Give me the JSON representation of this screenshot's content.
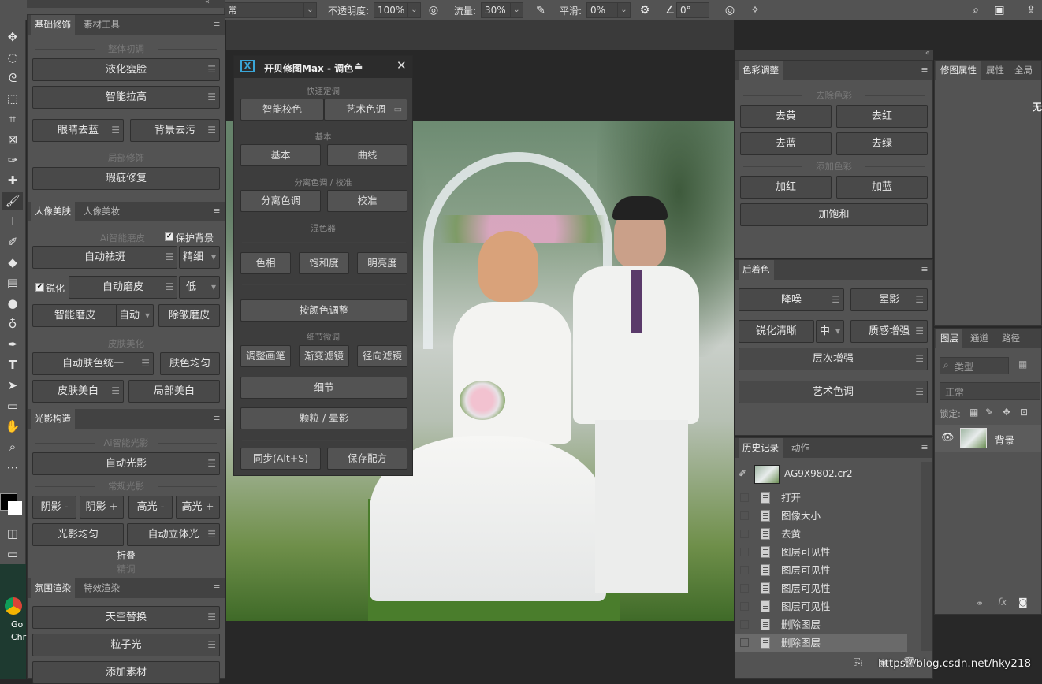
{
  "options_bar": {
    "mode_value": "常",
    "opacity_label": "不透明度:",
    "opacity_value": "100%",
    "flow_label": "流量:",
    "flow_value": "30%",
    "smooth_label": "平滑:",
    "smooth_value": "0%",
    "angle_value": "0°"
  },
  "left_panel": {
    "tabs1": [
      "基础修饰",
      "素材工具"
    ],
    "sec_overall": "整体初调",
    "btn_liquify": "液化瘦脸",
    "btn_stretch": "智能拉高",
    "btn_eye": "眼睛去蓝",
    "btn_bg": "背景去污",
    "sec_local": "局部修饰",
    "btn_blemish": "瑕疵修复",
    "tabs2": [
      "人像美肤",
      "人像美妆"
    ],
    "ai_skin": "Ai智能磨皮",
    "protect_bg": "保护背景",
    "btn_auto_spot": "自动祛斑",
    "fine_value": "精细",
    "sharpen_label": "锐化",
    "btn_auto_smooth": "自动磨皮",
    "low_value": "低",
    "btn_smart_smooth": "智能磨皮",
    "auto_value": "自动",
    "btn_wrinkle": "除皱磨皮",
    "sec_skin": "皮肤美化",
    "btn_tone_unify": "自动肤色统一",
    "btn_tone_even": "肤色均匀",
    "btn_whiten": "皮肤美白",
    "btn_local_whiten": "局部美白",
    "tabs3": [
      "光影构造"
    ],
    "ai_light": "Ai智能光影",
    "btn_auto_light": "自动光影",
    "sec_normal_light": "常规光影",
    "btn_shadow_minus": "阴影 -",
    "btn_shadow_plus": "阴影 +",
    "btn_high_minus": "高光 -",
    "btn_high_plus": "高光 +",
    "btn_light_even": "光影均匀",
    "btn_auto_3d": "自动立体光",
    "fold": "折叠",
    "fine_tune": "精调",
    "tabs4": [
      "氛围渲染",
      "特效渲染"
    ],
    "btn_sky": "天空替换",
    "btn_particle": "粒子光",
    "btn_add_material": "添加素材"
  },
  "dialog": {
    "title": "开贝修图Max - 调色",
    "sec_quick": "快速定调",
    "btn_smart_color": "智能校色",
    "btn_art_color": "艺术色调",
    "sec_basic": "基本",
    "btn_basic": "基本",
    "btn_curve": "曲线",
    "sec_split": "分离色调 / 校准",
    "btn_split": "分离色调",
    "btn_calib": "校准",
    "sec_mixer": "混色器",
    "btn_hue": "色相",
    "btn_sat": "饱和度",
    "btn_lum": "明亮度",
    "btn_by_color": "按颜色调整",
    "sec_detail": "细节微调",
    "btn_brush": "调整画笔",
    "btn_grad": "渐变滤镜",
    "btn_radial": "径向滤镜",
    "btn_detail": "细节",
    "btn_grain": "颗粒 / 晕影",
    "btn_sync": "同步(Alt+S)",
    "btn_save": "保存配方"
  },
  "color_panel": {
    "tab": "色彩调整",
    "sec_remove": "去除色彩",
    "btn_rm_yellow": "去黄",
    "btn_rm_red": "去红",
    "btn_rm_blue": "去蓝",
    "btn_rm_green": "去绿",
    "sec_add": "添加色彩",
    "btn_add_red": "加红",
    "btn_add_blue": "加蓝",
    "btn_add_sat": "加饱和"
  },
  "post_panel": {
    "tab": "后着色",
    "btn_denoise": "降噪",
    "btn_vignette": "晕影",
    "btn_sharpen": "锐化清晰",
    "mid_value": "中",
    "btn_texture": "质感增强",
    "btn_layer": "层次增强",
    "btn_art": "艺术色调"
  },
  "history_panel": {
    "tabs": [
      "历史记录",
      "动作"
    ],
    "snapshot": "AG9X9802.cr2",
    "items": [
      "打开",
      "图像大小",
      "去黄",
      "图层可见性",
      "图层可见性",
      "图层可见性",
      "图层可见性",
      "删除图层",
      "删除图层"
    ]
  },
  "props_panel": {
    "tabs": [
      "修图属性",
      "属性",
      "全局"
    ],
    "text": "无属"
  },
  "layers_panel": {
    "tabs": [
      "图层",
      "通道",
      "路径"
    ],
    "kind_placeholder": "类型",
    "blend_value": "正常",
    "lock_label": "锁定:",
    "layer_name": "背景"
  },
  "desktop": {
    "label1": "Go",
    "label2": "Chr"
  },
  "watermark": "https://blog.csdn.net/hky218"
}
